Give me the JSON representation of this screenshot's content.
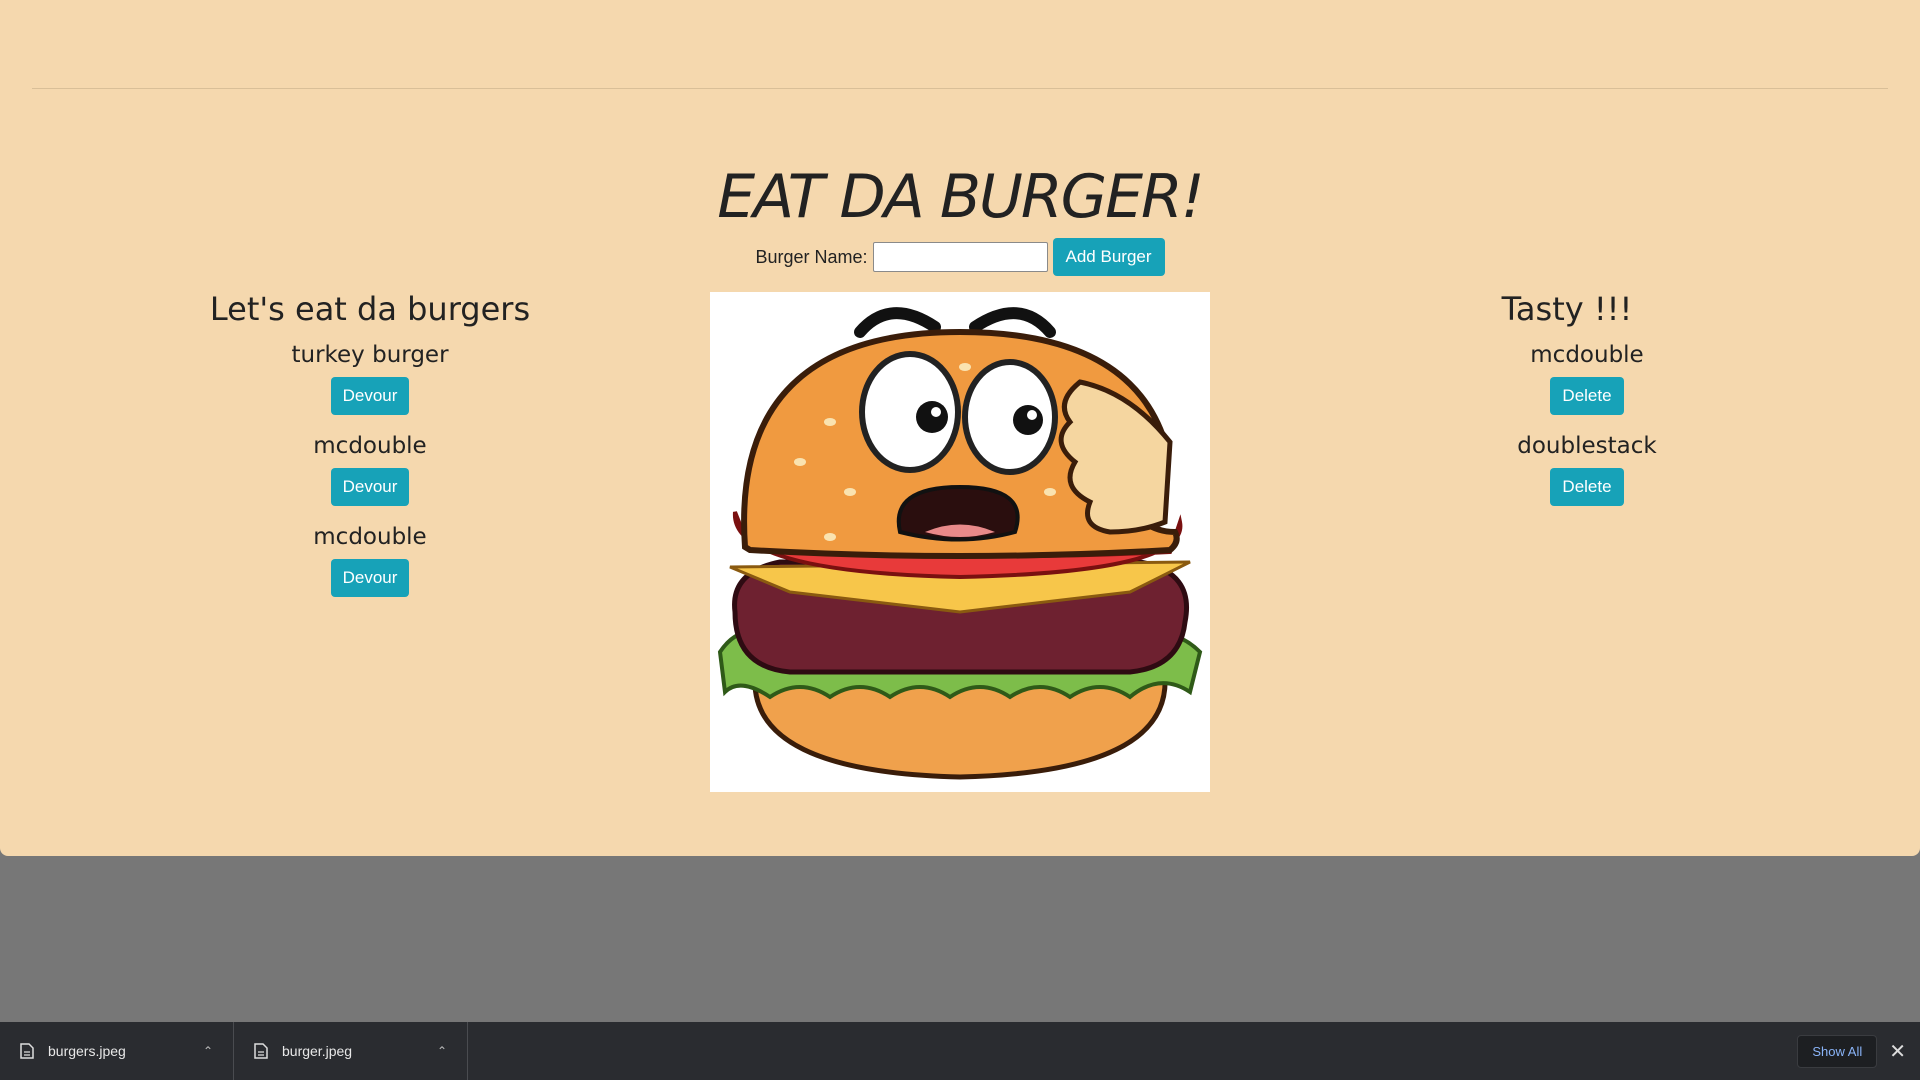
{
  "app": {
    "title": "EAT DA BURGER!",
    "accent": "#17a2b8",
    "background": "#f5d8ae"
  },
  "form": {
    "label": "Burger Name:",
    "input_value": "",
    "submit_label": "Add Burger"
  },
  "left": {
    "heading": "Let's eat da burgers",
    "items": [
      {
        "name": "turkey burger",
        "action": "Devour"
      },
      {
        "name": "mcdouble",
        "action": "Devour"
      },
      {
        "name": "mcdouble",
        "action": "Devour"
      }
    ]
  },
  "right": {
    "heading": "Tasty !!!",
    "items": [
      {
        "name": "mcdouble",
        "action": "Delete"
      },
      {
        "name": "doublestack",
        "action": "Delete"
      }
    ]
  },
  "image": {
    "icon": "cartoon-burger-image"
  },
  "downloads": {
    "items": [
      {
        "name": "burgers.jpeg"
      },
      {
        "name": "burger.jpeg"
      }
    ],
    "show_all": "Show All"
  }
}
